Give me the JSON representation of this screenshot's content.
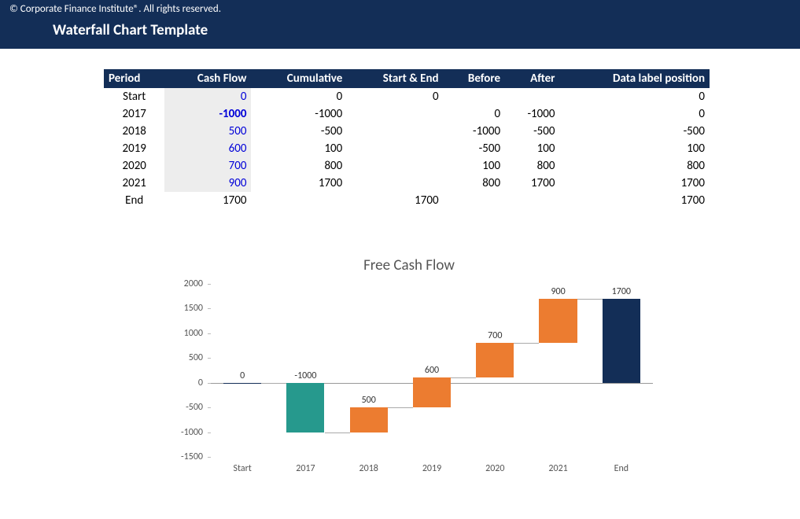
{
  "header": {
    "copyright": "© Corporate Finance Institute®. All rights reserved.",
    "title": "Waterfall Chart Template"
  },
  "table": {
    "headers": [
      "Period",
      "Cash Flow",
      "Cumulative",
      "Start & End",
      "Before",
      "After",
      "Data label position"
    ],
    "rows": [
      {
        "period": "Start",
        "cashflow": "0",
        "cashflow_bold": false,
        "cumulative": "0",
        "startend": "0",
        "before": "",
        "after": "",
        "labelpos": "0"
      },
      {
        "period": "2017",
        "cashflow": "-1000",
        "cashflow_bold": true,
        "cumulative": "-1000",
        "startend": "",
        "before": "0",
        "after": "-1000",
        "labelpos": "0"
      },
      {
        "period": "2018",
        "cashflow": "500",
        "cashflow_bold": false,
        "cumulative": "-500",
        "startend": "",
        "before": "-1000",
        "after": "-500",
        "labelpos": "-500"
      },
      {
        "period": "2019",
        "cashflow": "600",
        "cashflow_bold": false,
        "cumulative": "100",
        "startend": "",
        "before": "-500",
        "after": "100",
        "labelpos": "100"
      },
      {
        "period": "2020",
        "cashflow": "700",
        "cashflow_bold": false,
        "cumulative": "800",
        "startend": "",
        "before": "100",
        "after": "800",
        "labelpos": "800"
      },
      {
        "period": "2021",
        "cashflow": "900",
        "cashflow_bold": false,
        "cumulative": "1700",
        "startend": "",
        "before": "800",
        "after": "1700",
        "labelpos": "1700"
      },
      {
        "period": "End",
        "cashflow": "1700",
        "cashflow_bold": false,
        "cashflow_plain": true,
        "cumulative": "",
        "startend": "1700",
        "before": "",
        "after": "",
        "labelpos": "1700"
      }
    ]
  },
  "chart_data": {
    "type": "waterfall",
    "title": "Free Cash Flow",
    "categories": [
      "Start",
      "2017",
      "2018",
      "2019",
      "2020",
      "2021",
      "End"
    ],
    "values": [
      0,
      -1000,
      500,
      600,
      700,
      900,
      1700
    ],
    "cumulative": [
      0,
      -1000,
      -500,
      100,
      800,
      1700,
      1700
    ],
    "is_total": [
      true,
      false,
      false,
      false,
      false,
      false,
      true
    ],
    "data_labels": [
      0,
      -1000,
      500,
      600,
      700,
      900,
      1700
    ],
    "ylim": [
      -1500,
      2000
    ],
    "yticks": [
      -1500,
      -1000,
      -500,
      0,
      500,
      1000,
      1500,
      2000
    ],
    "colors": {
      "total": "#132e57",
      "increase": "#ec7c30",
      "decrease": "#26998d"
    }
  }
}
